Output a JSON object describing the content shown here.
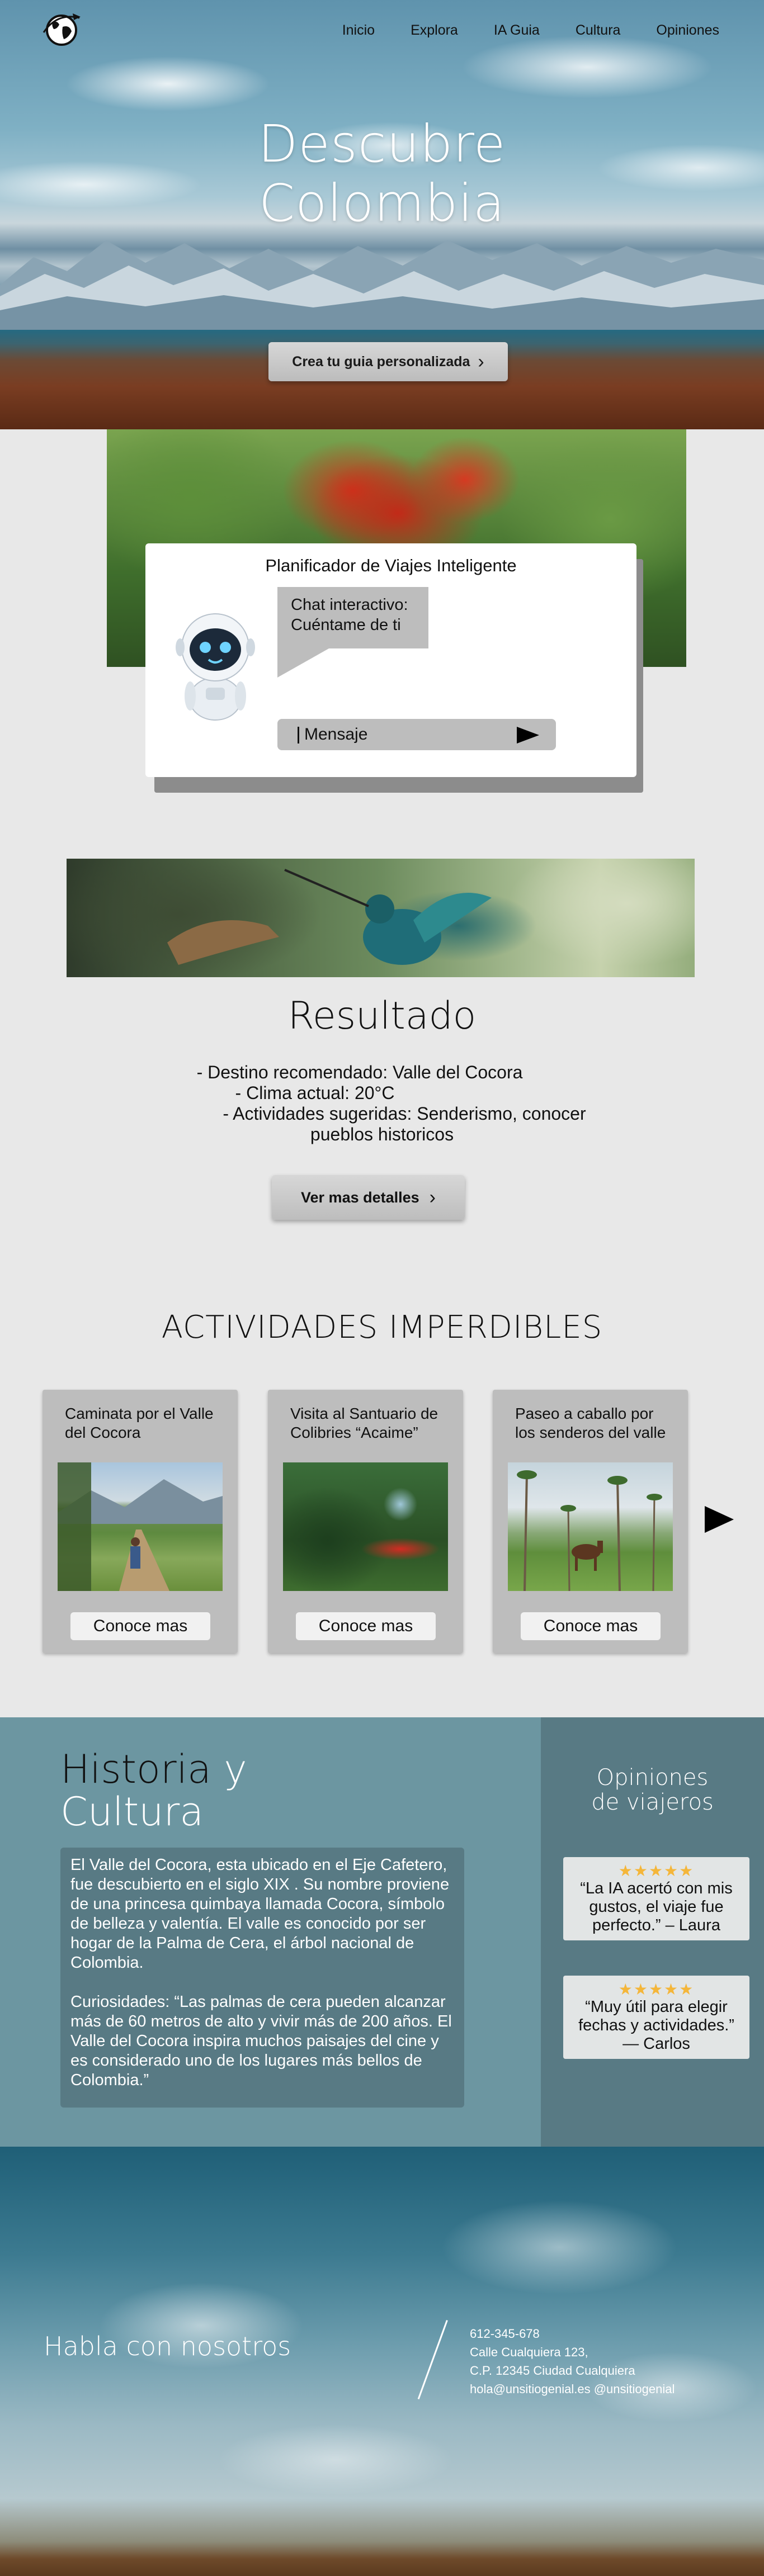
{
  "nav": {
    "links": [
      "Inicio",
      "Explora",
      "IA Guia",
      "Cultura",
      "Opiniones"
    ]
  },
  "hero": {
    "title_line1": "Descubre",
    "title_line2": "Colombia",
    "cta_label": "Crea tu guia personalizada"
  },
  "planner": {
    "title": "Planificador de Viajes Inteligente",
    "bubble_line1": "Chat interactivo:",
    "bubble_line2": "Cuéntame de ti",
    "message_placeholder": "Mensaje"
  },
  "result": {
    "title": "Resultado",
    "line1": "- Destino recomendado: Valle del Cocora",
    "line2": "- Clima actual: 20°C",
    "line3": "- Actividades sugeridas: Senderismo, conocer",
    "line4": "pueblos historicos",
    "details_label": "Ver mas detalles"
  },
  "activities": {
    "title": "ACTIVIDADES IMPERDIBLES",
    "cards": [
      {
        "title": "Caminata por el Valle del Cocora",
        "button": "Conoce mas"
      },
      {
        "title": "Visita al Santuario de Colibries “Acaime”",
        "button": "Conoce mas"
      },
      {
        "title": "Paseo a caballo por los senderos del valle",
        "button": "Conoce mas"
      }
    ]
  },
  "history": {
    "title_word1": "Historia",
    "title_word2": "y",
    "title_word3": "Cultura",
    "paragraph1": "El Valle del Cocora, esta ubicado en el Eje Cafetero, fue descubierto en el siglo XIX . Su nombre proviene de una princesa quimbaya llamada Cocora, símbolo de belleza y valentía. El valle es conocido por ser hogar de la Palma de Cera, el árbol nacional de Colombia.",
    "paragraph2": "Curiosidades: “Las palmas de cera pueden alcanzar más de 60 metros de alto y vivir más de 200 años. El Valle del Cocora inspira muchos paisajes del cine y es considerado uno de los lugares más bellos de Colombia.”"
  },
  "opinions": {
    "title_line1": "Opiniones",
    "title_line2": "de viajeros",
    "stars": "★★★★★",
    "reviews": [
      {
        "text": "“La IA acertó con mis gustos, el viaje fue perfecto.” – Laura"
      },
      {
        "text": "“Muy útil para elegir fechas y actividades.” — Carlos"
      }
    ]
  },
  "footer": {
    "talk": "Habla con nosotros",
    "phone": "612-345-678",
    "address1": "Calle Cualquiera 123,",
    "address2": "C.P. 12345 Ciudad Cualquiera",
    "email_social": "hola@unsitiogenial.es @unsitiogenial"
  },
  "colors": {
    "history_bg": "#6c96a1",
    "opinions_bg": "#587a84",
    "card_bg": "#bdbdbd",
    "star": "#f4b63a"
  }
}
